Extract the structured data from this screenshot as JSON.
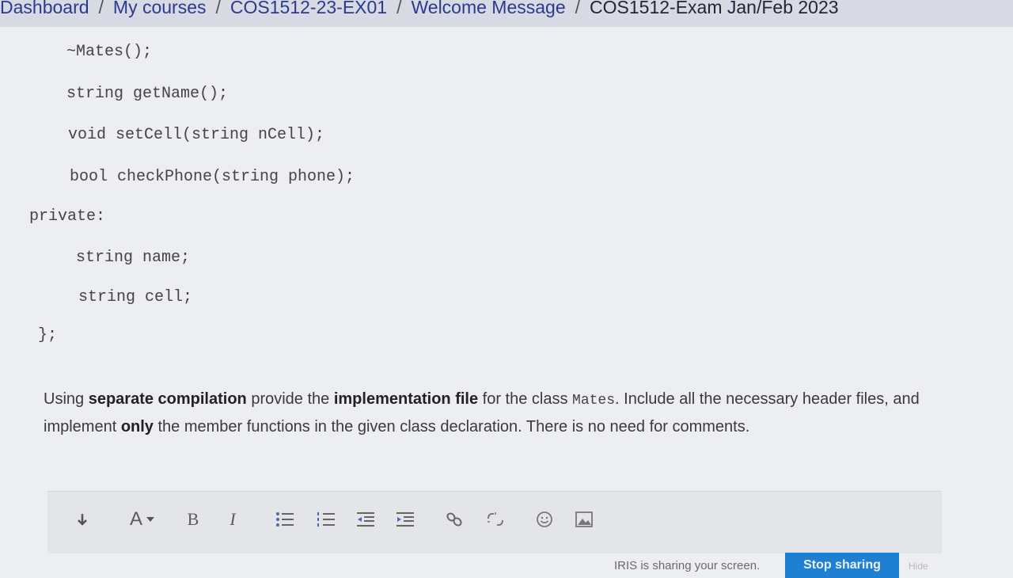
{
  "breadcrumb": {
    "items": [
      "Dashboard",
      "My courses",
      "COS1512-23-EX01",
      "Welcome Message",
      "COS1512-Exam Jan/Feb 2023"
    ],
    "separator": "/"
  },
  "code": {
    "lines": [
      "~Mates();",
      "string getName();",
      "void setCell(string nCell);",
      "bool checkPhone(string phone);",
      "private:",
      "string name;",
      "string cell;",
      "};"
    ]
  },
  "question": {
    "p1": "Using ",
    "b1": "separate compilation",
    "p2": " provide the ",
    "b2": "implementation file",
    "p3": " for the class ",
    "class_name": "Mates",
    "p4": ". Include all the necessary header files, and implement ",
    "b3": "only",
    "p5": " the member functions in the given class declaration. There is no need for comments."
  },
  "toolbar": {
    "font_label": "A",
    "bold_label": "B",
    "italic_label": "I",
    "icons": [
      "collapse-icon",
      "font-color-icon",
      "bold-icon",
      "italic-icon",
      "unordered-list-icon",
      "ordered-list-icon",
      "outdent-icon",
      "indent-icon",
      "link-icon",
      "unlink-icon",
      "emoji-icon",
      "image-icon"
    ]
  },
  "share": {
    "message": "IRIS is sharing your screen.",
    "stop_label": "Stop sharing",
    "hide_label": "Hide"
  }
}
